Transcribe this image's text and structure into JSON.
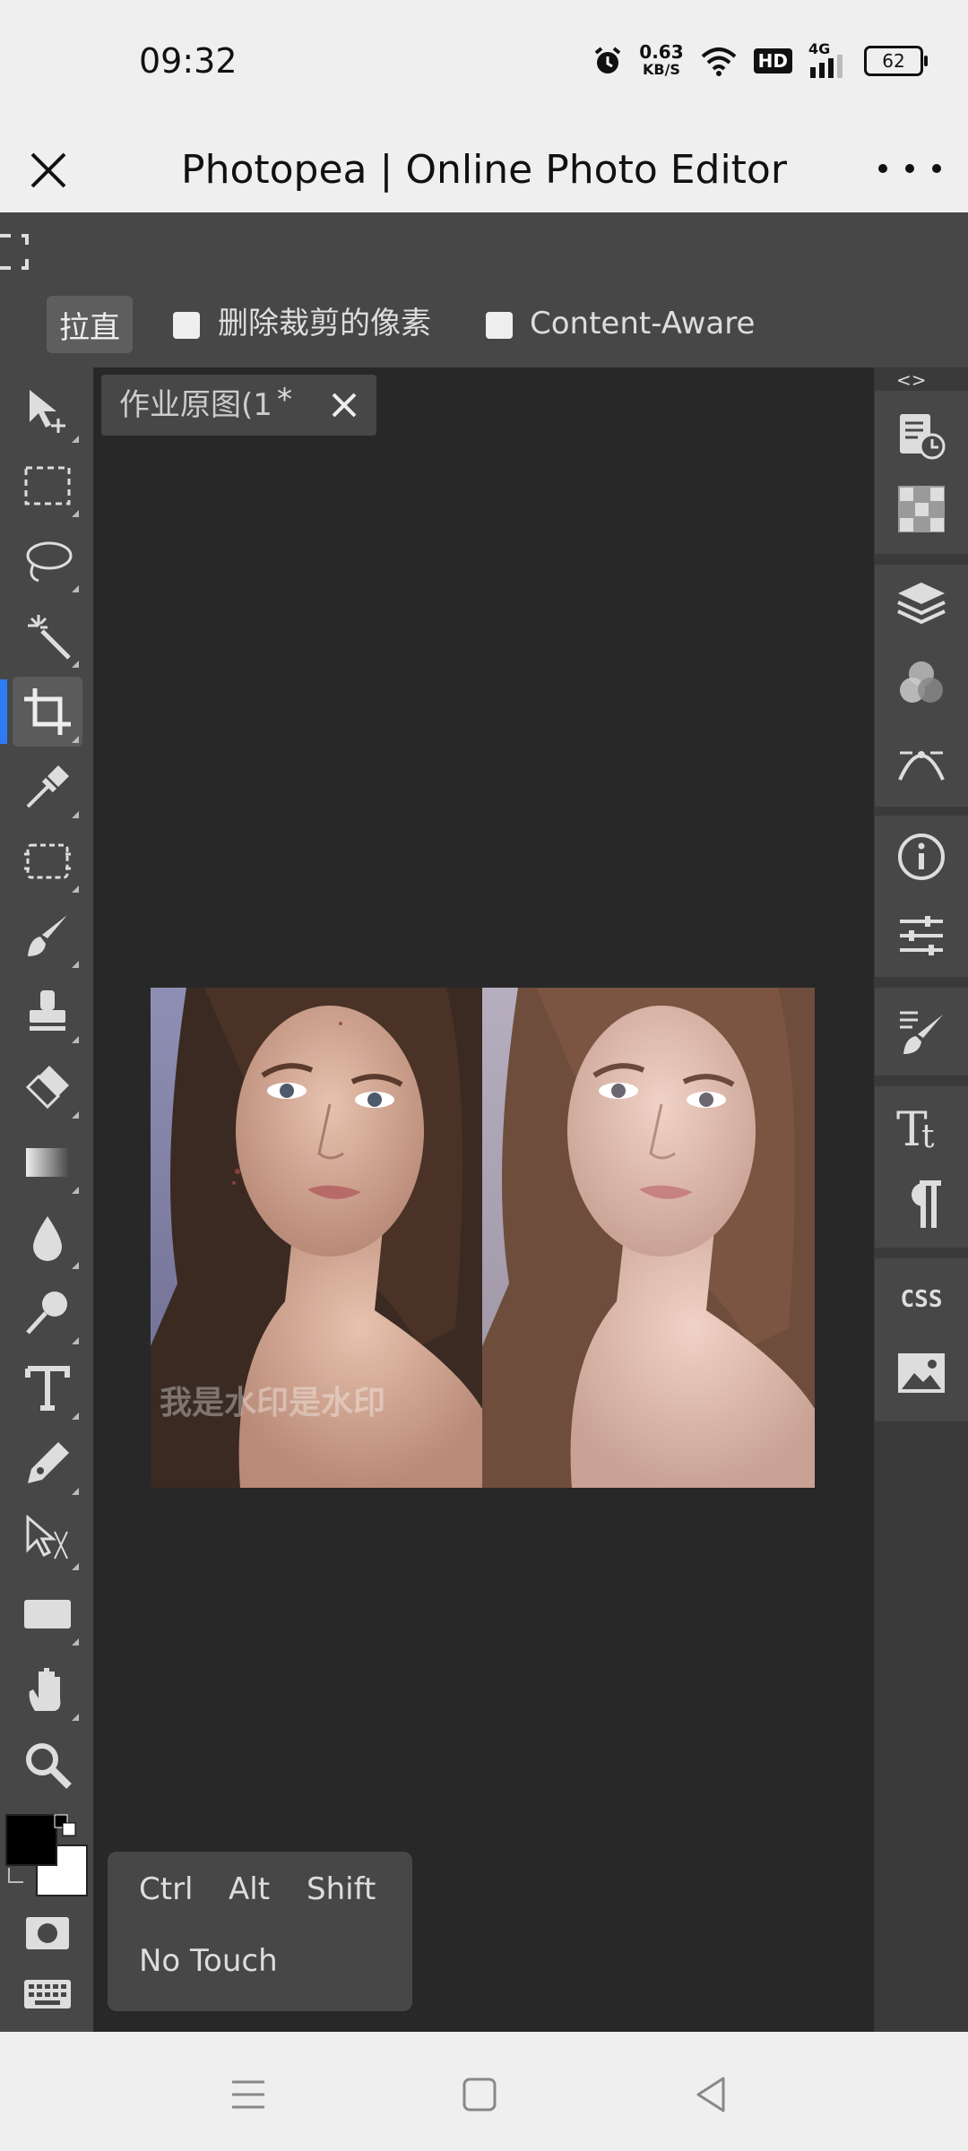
{
  "status": {
    "time": "09:32",
    "net_speed_value": "0.63",
    "net_speed_unit": "KB/S",
    "hd": "HD",
    "network": "4G",
    "battery": "62"
  },
  "titlebar": {
    "title": "Photopea | Online Photo Editor"
  },
  "options": {
    "straighten_label": "拉直",
    "delete_cropped_label": "删除裁剪的像素",
    "content_aware_label": "Content-Aware"
  },
  "document": {
    "tab_label": "作业原图(1",
    "dirty_marker": "*",
    "watermark_text": "我是水印是水印"
  },
  "right_panel": {
    "toggle_label": "<>",
    "css_label": "CSS"
  },
  "modifiers": {
    "ctrl": "Ctrl",
    "alt": "Alt",
    "shift": "Shift",
    "no_touch": "No Touch"
  },
  "colors": {
    "accent": "#2d7cf6",
    "app_bg": "#474747",
    "workspace_bg": "#282828",
    "foreground_color": "#000000",
    "background_color": "#ffffff"
  },
  "toolbar": {
    "tools": [
      "move-tool",
      "marquee-tool",
      "lasso-tool",
      "magic-wand-tool",
      "crop-tool",
      "eyedropper-tool",
      "frame-tool",
      "brush-tool",
      "stamp-tool",
      "eraser-tool",
      "gradient-tool",
      "blur-tool",
      "dodge-tool",
      "type-tool",
      "pen-tool",
      "path-select-tool",
      "shape-tool",
      "hand-tool",
      "zoom-tool"
    ],
    "active_tool": "crop-tool"
  }
}
